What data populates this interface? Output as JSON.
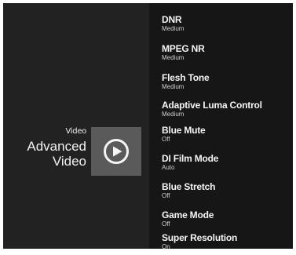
{
  "header": {
    "breadcrumb": "Video",
    "title": "Advanced Video",
    "tile_icon": "play-circle-icon"
  },
  "settings": [
    {
      "name": "DNR",
      "value": "Medium"
    },
    {
      "name": "MPEG NR",
      "value": "Medium"
    },
    {
      "name": "Flesh Tone",
      "value": "Medium"
    },
    {
      "name": "Adaptive Luma Control",
      "value": "Medium"
    },
    {
      "name": "Blue Mute",
      "value": "Off"
    },
    {
      "name": "DI Film Mode",
      "value": "Auto"
    },
    {
      "name": "Blue Stretch",
      "value": "Off"
    },
    {
      "name": "Game Mode",
      "value": "Off"
    },
    {
      "name": "Super Resolution",
      "value": "On"
    }
  ],
  "colors": {
    "left_panel": "#222222",
    "right_panel": "#161616",
    "tile": "#5a5a5a",
    "text": "#f5f5f5"
  }
}
